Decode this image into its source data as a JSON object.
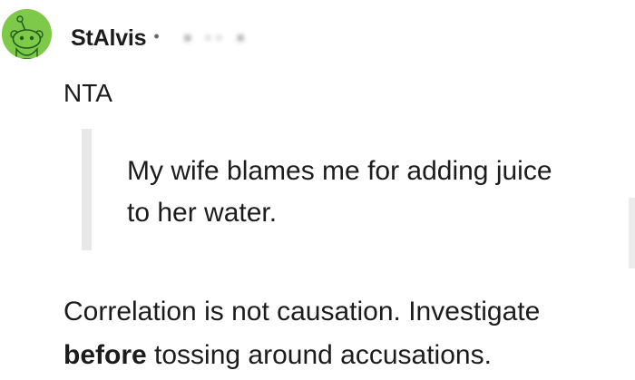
{
  "comment": {
    "author": "StAlvis",
    "separator": "•",
    "timestamp_obscured": "• ·· •",
    "verdict": "NTA",
    "quote": "My wife blames me for adding juice to her water.",
    "body_before": "Correlation is not causation. Investigate ",
    "body_bold": "before",
    "body_after": " tossing around accusations."
  },
  "icons": {
    "avatar": "reddit-snoo-avatar-icon"
  },
  "colors": {
    "avatar_bg": "#7fc94a",
    "quote_bar": "#e8e8e8",
    "text": "#1c1c1c"
  }
}
